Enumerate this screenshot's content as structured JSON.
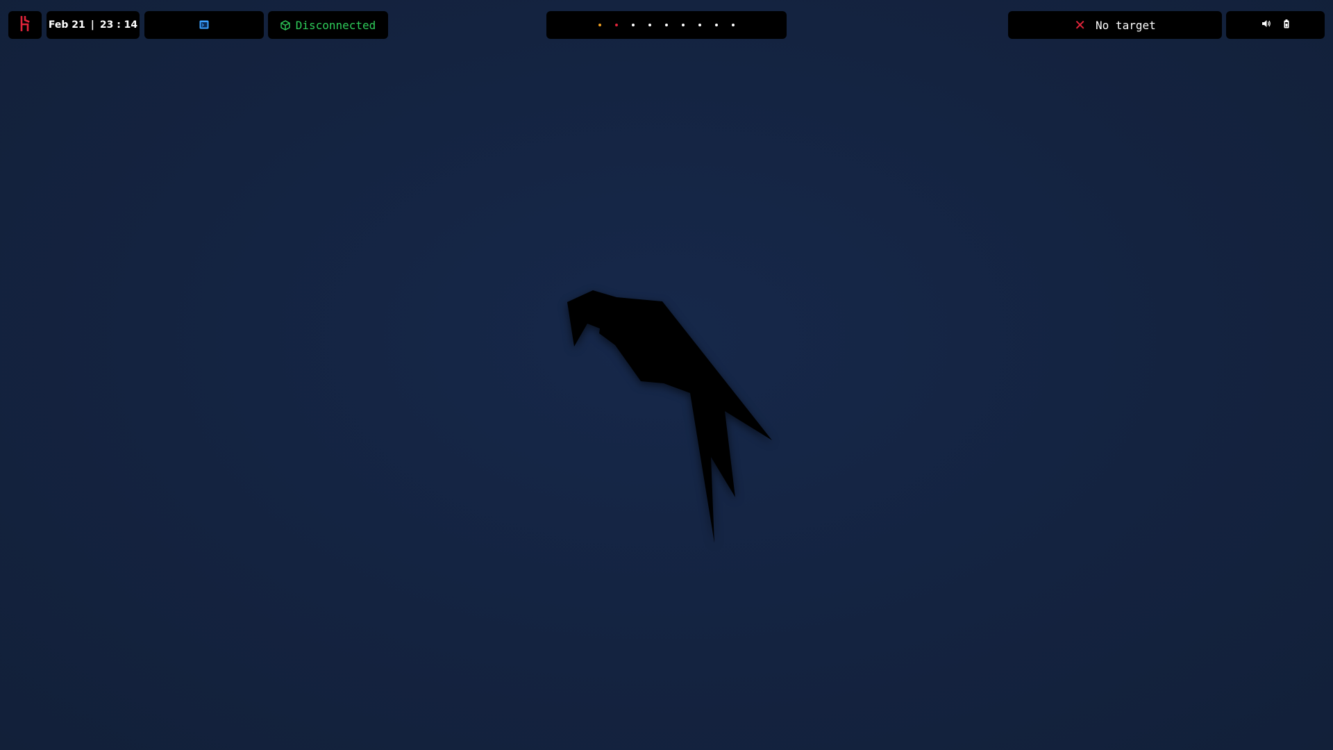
{
  "topbar": {
    "logo": {
      "icon": "hack-the-box-logo-icon",
      "color": "#e0243a"
    },
    "clock": {
      "date": "Feb 21",
      "separator": "|",
      "time": "23 : 14"
    },
    "window": {
      "icon": "terminal-window-icon",
      "color": "#3aa0ff"
    },
    "vpn": {
      "status": "Disconnected",
      "icon": "cube-icon",
      "color": "#2ecc5a"
    },
    "workspaces": {
      "count": 9,
      "colors": [
        "#f0a020",
        "#e0243a",
        "#ffffff",
        "#ffffff",
        "#ffffff",
        "#ffffff",
        "#ffffff",
        "#ffffff",
        "#ffffff"
      ]
    },
    "target": {
      "label": "No target",
      "icon": "close-x-icon",
      "color": "#e0243a"
    },
    "system": {
      "icons": [
        "volume-icon",
        "battery-icon"
      ]
    }
  },
  "wallpaper": {
    "background": "#142340",
    "emblem": "parrot-silhouette"
  }
}
